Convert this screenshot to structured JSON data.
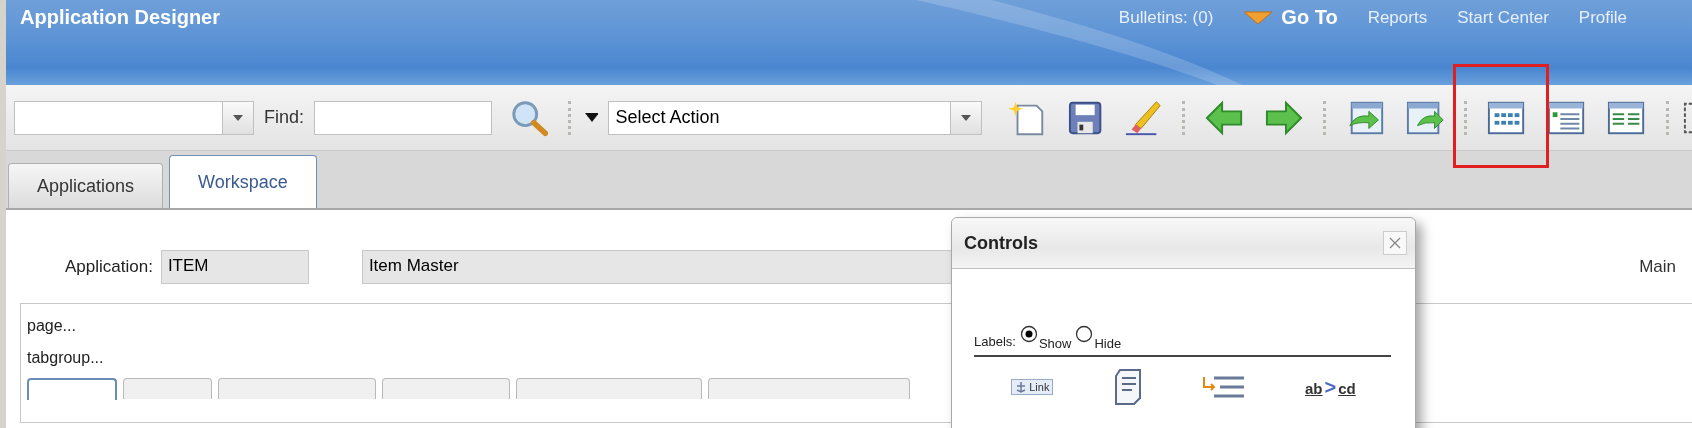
{
  "header": {
    "title": "Application Designer",
    "links": [
      {
        "label": "Bulletins: (0)",
        "kind": "link"
      },
      {
        "label": "Go To",
        "kind": "menu"
      },
      {
        "label": "Reports",
        "kind": "link"
      },
      {
        "label": "Start Center",
        "kind": "link"
      },
      {
        "label": "Profile",
        "kind": "link"
      }
    ]
  },
  "toolbar": {
    "find_label": "Find:",
    "action_select": "Select Action"
  },
  "tabs": [
    {
      "label": "Applications",
      "selected": false
    },
    {
      "label": "Workspace",
      "selected": true
    }
  ],
  "form": {
    "label": "Application:",
    "code": "ITEM",
    "description": "Item Master",
    "right_label": "Main"
  },
  "outline": {
    "lines": [
      "page...",
      "tabgroup..."
    ],
    "sub_tabs": [
      {
        "selected": true
      },
      {
        "selected": false
      },
      {
        "selected": false
      },
      {
        "selected": false
      },
      {
        "selected": false
      },
      {
        "selected": false
      }
    ]
  },
  "dialog": {
    "title": "Controls",
    "labels_label": "Labels:",
    "options": [
      {
        "label": "Show",
        "selected": true
      },
      {
        "label": "Hide",
        "selected": false
      }
    ],
    "palette": [
      {
        "kind": "link",
        "label": "Link"
      },
      {
        "kind": "notebook"
      },
      {
        "kind": "indent"
      },
      {
        "kind": "mapping",
        "from": "ab",
        "arrow": ">",
        "to": "cd"
      }
    ]
  }
}
